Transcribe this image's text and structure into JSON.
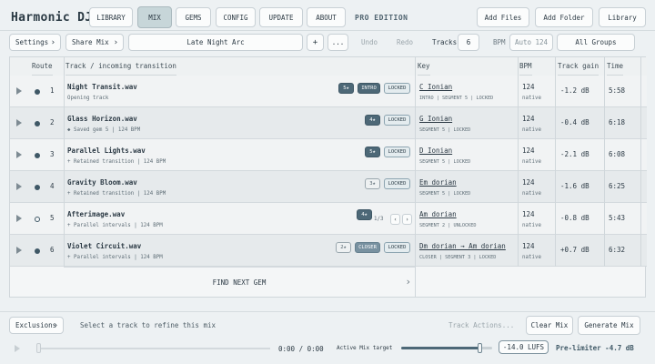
{
  "app": {
    "logo": "Harmonic DJ",
    "edition": "PRO EDITION"
  },
  "nav": {
    "tabs": [
      {
        "label": "LIBRARY",
        "active": false
      },
      {
        "label": "MIX",
        "active": true
      },
      {
        "label": "GEMS",
        "active": false
      },
      {
        "label": "CONFIG",
        "active": false
      },
      {
        "label": "UPDATE",
        "active": false
      },
      {
        "label": "ABOUT",
        "active": false
      }
    ],
    "actions": {
      "add_files": "Add Files",
      "add_folder": "Add Folder",
      "library": "Library"
    }
  },
  "controls": {
    "settings": "Settings",
    "share_mix": "Share Mix",
    "mix_name": "Late Night Arc",
    "plus": "+",
    "more": "...",
    "undo": "Undo",
    "redo": "Redo",
    "tracks_label": "Tracks",
    "tracks_value": "6",
    "bpm_label": "BPM",
    "bpm_placeholder": "Auto 124",
    "all_groups": "All Groups"
  },
  "table": {
    "headers": {
      "route": "Route",
      "track": "Track / incoming transition",
      "key": "Key",
      "bpm": "BPM",
      "gain": "Track gain",
      "time": "Time"
    },
    "rows": [
      {
        "num": "1",
        "title": "Night Transit.wav",
        "sub": "Opening track",
        "chips": [
          "5★",
          "INTRO",
          "LOCKED"
        ],
        "key": "C Ionian",
        "key_sub": "INTRO | SEGMENT 5 | LOCKED",
        "bpm": "124",
        "bpm_sub": "native",
        "gain": "-1.2 dB",
        "time": "5:58"
      },
      {
        "num": "2",
        "title": "Glass Horizon.wav",
        "sub": "◆  Saved gem 5 | 124 BPM",
        "chips": [
          "4★",
          "LOCKED"
        ],
        "key": "G Ionian",
        "key_sub": "SEGMENT 5 | LOCKED",
        "bpm": "124",
        "bpm_sub": "native",
        "gain": "-0.4 dB",
        "time": "6:18"
      },
      {
        "num": "3",
        "title": "Parallel Lights.wav",
        "sub": "+  Retained transition | 124 BPM",
        "chips": [
          "5★",
          "LOCKED"
        ],
        "key": "D Ionian",
        "key_sub": "SEGMENT 5 | LOCKED",
        "bpm": "124",
        "bpm_sub": "native",
        "gain": "-2.1 dB",
        "time": "6:08"
      },
      {
        "num": "4",
        "title": "Gravity Bloom.wav",
        "sub": "+  Retained transition | 124 BPM",
        "chips": [
          "3★",
          "LOCKED"
        ],
        "key": "Em dorian",
        "key_sub": "SEGMENT 5 | LOCKED",
        "bpm": "124",
        "bpm_sub": "native",
        "gain": "-1.6 dB",
        "time": "6:25"
      },
      {
        "num": "5",
        "title": "Afterimage.wav",
        "sub": "+  Parallel intervals | 124 BPM",
        "chips": [
          "4★"
        ],
        "pager": "1/3",
        "key": "Am dorian",
        "key_sub": "SEGMENT 2 | UNLOCKED",
        "bpm": "124",
        "bpm_sub": "native",
        "gain": "-0.8 dB",
        "time": "5:43"
      },
      {
        "num": "6",
        "title": "Violet Circuit.wav",
        "sub": "+  Parallel intervals | 124 BPM",
        "chips": [
          "2★",
          "CLOSER",
          "LOCKED"
        ],
        "key": "Dm dorian → Am dorian",
        "key_sub": "CLOSER | SEGMENT 3 | LOCKED",
        "bpm": "124",
        "bpm_sub": "native",
        "gain": "+0.7 dB",
        "time": "6:32"
      }
    ],
    "find_next_gem": "FIND NEXT GEM"
  },
  "footer": {
    "exclusions": "Exclusions",
    "hint": "Select a track to refine this mix",
    "track_actions": "Track Actions...",
    "clear_mix": "Clear Mix",
    "generate_mix": "Generate Mix"
  },
  "player": {
    "time": "0:00 / 0:00",
    "target_label": "Active Mix target",
    "target_level": 0.86,
    "lufs": "-14.0 LUFS",
    "prelimiter": "Pre-limiter -4.7 dB"
  },
  "colors": {
    "accent": "#4d6877",
    "active_tab": "#c7d6d9",
    "background": "#edf1f3"
  }
}
